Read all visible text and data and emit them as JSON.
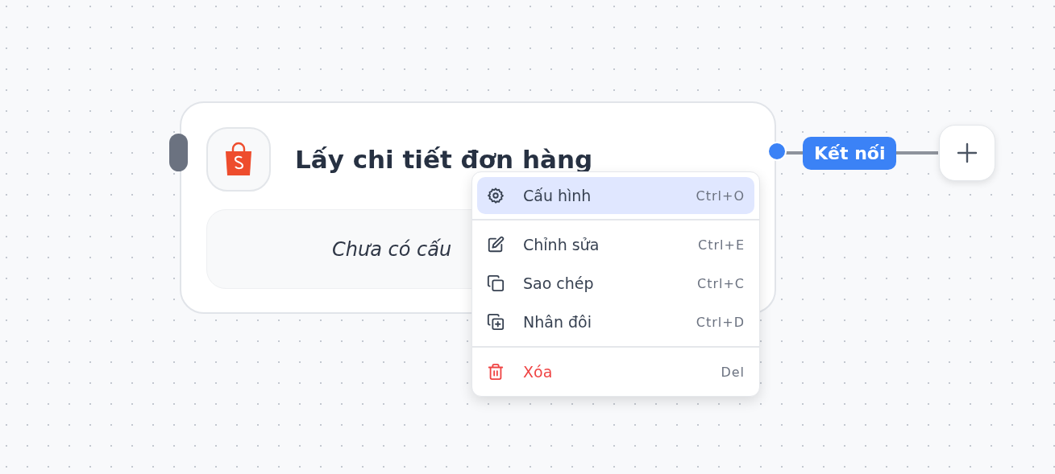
{
  "node": {
    "title": "Lấy chi tiết đơn hàng",
    "placeholder_text": "Chưa có cấu"
  },
  "connector": {
    "label": "Kết nối"
  },
  "context_menu": {
    "groups": [
      [
        {
          "label": "Cấu hình",
          "shortcut": "Ctrl+O",
          "kind": "normal",
          "selected": true
        }
      ],
      [
        {
          "label": "Chỉnh sửa",
          "shortcut": "Ctrl+E",
          "kind": "normal",
          "selected": false
        },
        {
          "label": "Sao chép",
          "shortcut": "Ctrl+C",
          "kind": "normal",
          "selected": false
        },
        {
          "label": "Nhân đôi",
          "shortcut": "Ctrl+D",
          "kind": "normal",
          "selected": false
        }
      ],
      [
        {
          "label": "Xóa",
          "shortcut": "Del",
          "kind": "danger",
          "selected": false
        }
      ]
    ]
  }
}
